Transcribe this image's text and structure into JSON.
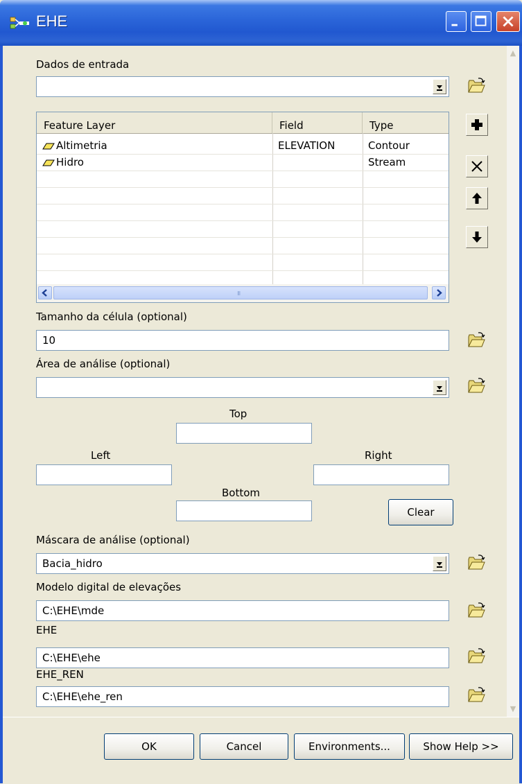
{
  "window": {
    "title": "EHE",
    "accent": "#2458d3",
    "close_color": "#c7422a"
  },
  "dados_entrada": {
    "label": "Dados de entrada",
    "value": ""
  },
  "grid": {
    "columns": [
      "Feature Layer",
      "Field",
      "Type"
    ],
    "rows": [
      {
        "layer": "Altimetria",
        "field": "ELEVATION",
        "type": "Contour",
        "icon": "polygon-layer-icon"
      },
      {
        "layer": "Hidro",
        "field": "",
        "type": "Stream",
        "icon": "polygon-layer-icon"
      }
    ],
    "grip": "III"
  },
  "side_buttons": [
    "add-icon",
    "remove-icon",
    "up-arrow-icon",
    "down-arrow-icon"
  ],
  "cell_size": {
    "label": "Tamanho da célula (optional)",
    "value": "10"
  },
  "area": {
    "label": "Área de análise (optional)",
    "value": "",
    "top_label": "Top",
    "left_label": "Left",
    "right_label": "Right",
    "bottom_label": "Bottom",
    "top_value": "",
    "left_value": "",
    "right_value": "",
    "bottom_value": "",
    "clear_label": "Clear"
  },
  "mask": {
    "label": "Máscara de análise (optional)",
    "value": "Bacia_hidro"
  },
  "mde": {
    "label": "Modelo digital de elevações",
    "value": "C:\\EHE\\mde"
  },
  "ehe": {
    "label": "EHE",
    "value": "C:\\EHE\\ehe"
  },
  "ehe_ren": {
    "label": "EHE_REN",
    "value": "C:\\EHE\\ehe_ren"
  },
  "footer": {
    "ok": "OK",
    "cancel": "Cancel",
    "environments": "Environments...",
    "show_help": "Show Help >>"
  }
}
